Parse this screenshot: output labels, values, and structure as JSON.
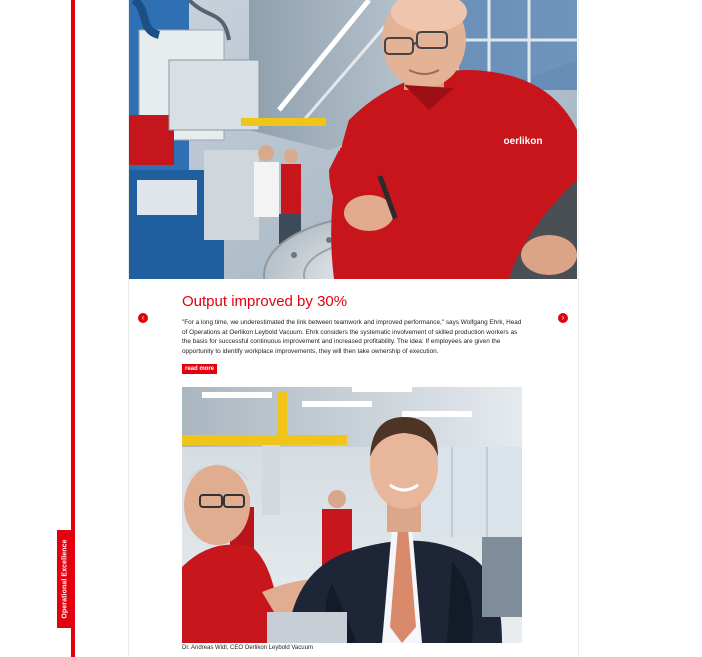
{
  "sidebar": {
    "section_label": "Operational Excellence"
  },
  "hero": {
    "shirt_logo": "oerlikon"
  },
  "article": {
    "headline": "Output improved by 30%",
    "body": "\"For a long time, we underestimated the link between teamwork and improved performance,\" says Wolfgang Ehrk, Head of Operations at Oerlikon Leybold Vacuum. Ehrk considers the systematic involvement of skilled production workers as the basis for successful continuous improvement and increased profitability. The idea: If employees are given the opportunity to identify workplace improvements, they will then take ownership of execution.",
    "read_more_label": "read more",
    "prev_icon": "chevron-left-icon",
    "next_icon": "chevron-right-icon"
  },
  "photo_caption": "Dr. Andreas Widl, CEO Oerlikon Leybold Vacuum",
  "colors": {
    "accent": "#e3000f",
    "text": "#222222",
    "background": "#ffffff"
  }
}
